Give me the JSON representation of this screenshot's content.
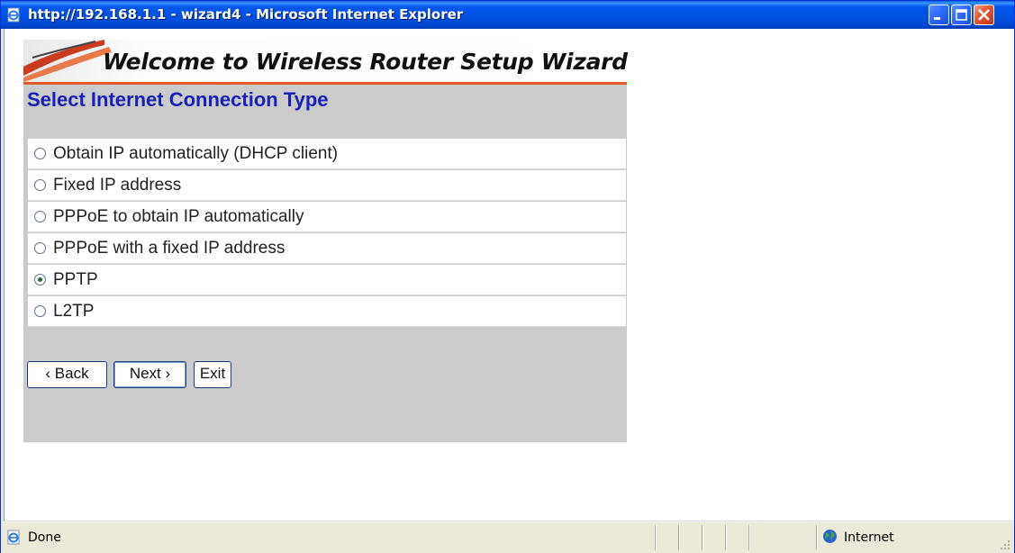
{
  "window": {
    "title": "http://192.168.1.1 - wizard4 - Microsoft Internet Explorer"
  },
  "page": {
    "banner_title": "Welcome to Wireless Router Setup Wizard",
    "heading": "Select Internet Connection Type",
    "options": [
      {
        "label": "Obtain IP automatically (DHCP client)",
        "selected": false
      },
      {
        "label": "Fixed IP address",
        "selected": false
      },
      {
        "label": "PPPoE to obtain IP automatically",
        "selected": false
      },
      {
        "label": "PPPoE with a fixed IP address",
        "selected": false
      },
      {
        "label": "PPTP",
        "selected": true
      },
      {
        "label": "L2TP",
        "selected": false
      }
    ],
    "buttons": {
      "back": "‹ Back",
      "next": "Next ›",
      "exit": "Exit"
    }
  },
  "statusbar": {
    "status": "Done",
    "zone": "Internet"
  },
  "colors": {
    "heading": "#1a21b8",
    "titlebar": "#0050e0",
    "banner_accent": "#e05a2a"
  }
}
